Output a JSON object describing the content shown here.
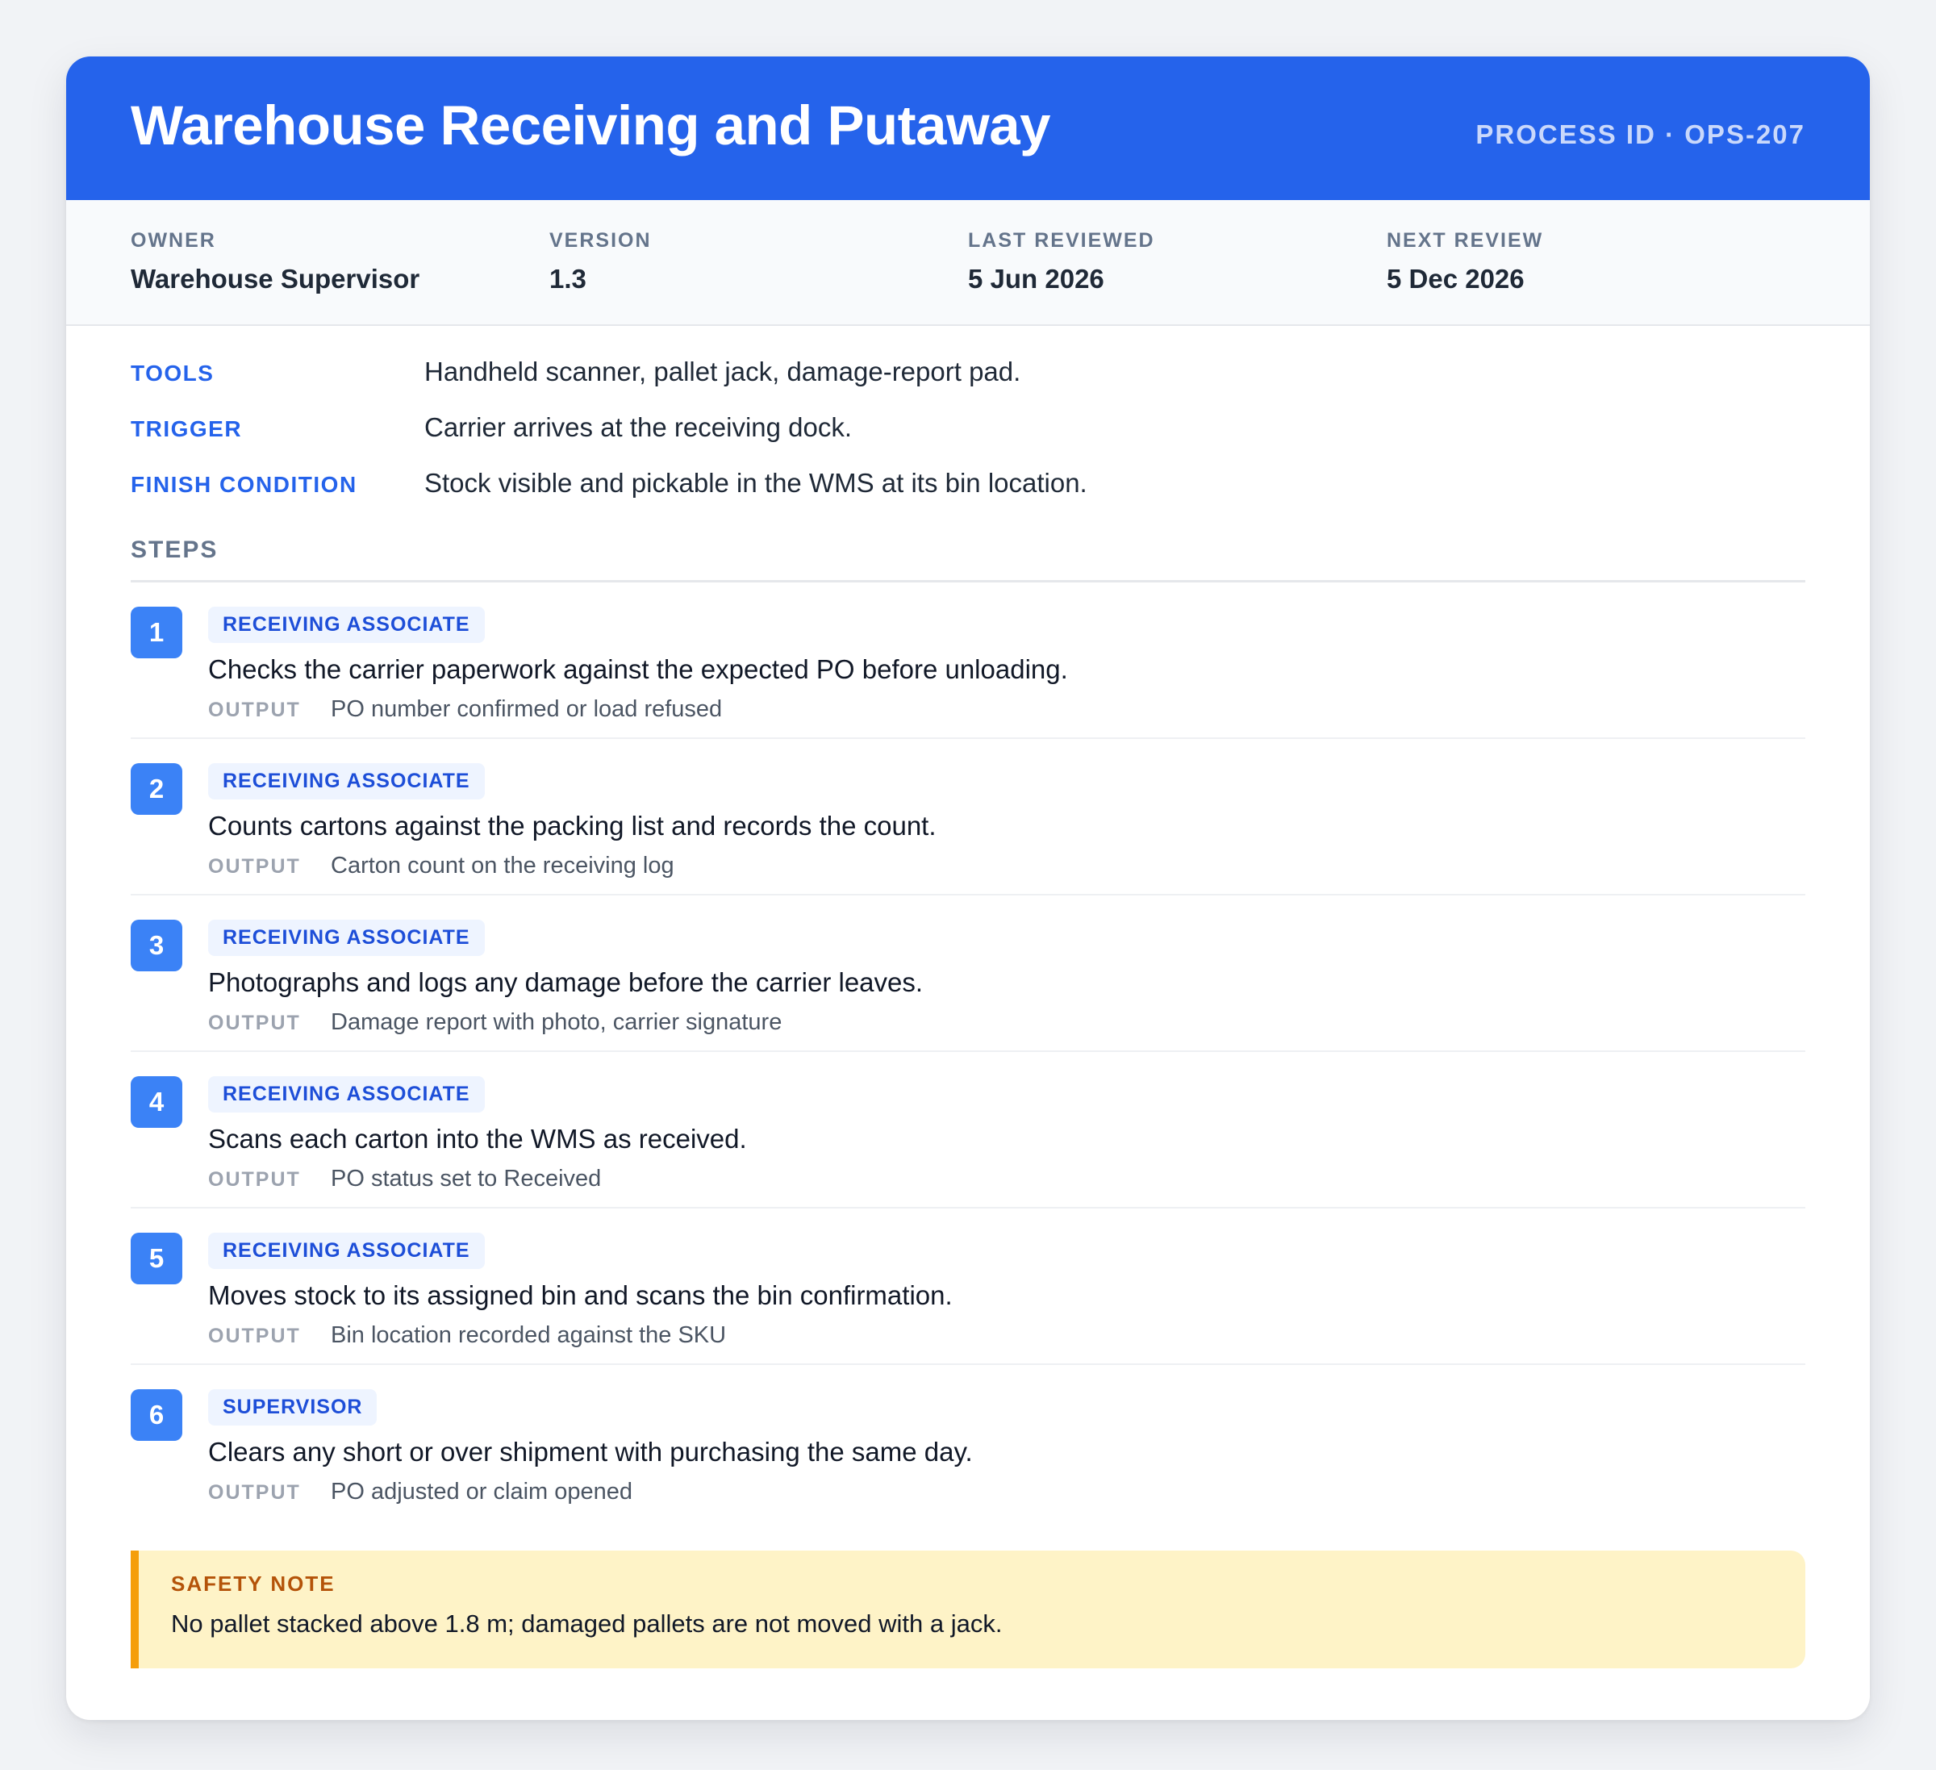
{
  "header": {
    "title": "Warehouse Receiving and Putaway",
    "process_id": "PROCESS ID · OPS-207"
  },
  "meta": [
    {
      "label": "OWNER",
      "value": "Warehouse Supervisor"
    },
    {
      "label": "VERSION",
      "value": "1.3"
    },
    {
      "label": "LAST REVIEWED",
      "value": "5 Jun 2026"
    },
    {
      "label": "NEXT REVIEW",
      "value": "5 Dec 2026"
    }
  ],
  "info": {
    "tools": {
      "label": "TOOLS",
      "value": "Handheld scanner, pallet jack, damage-report pad."
    },
    "trigger": {
      "label": "TRIGGER",
      "value": "Carrier arrives at the receiving dock."
    },
    "finish": {
      "label": "FINISH CONDITION",
      "value": "Stock visible and pickable in the WMS at its bin location."
    }
  },
  "steps_heading": "STEPS",
  "output_label": "OUTPUT",
  "steps": [
    {
      "num": "1",
      "role": "RECEIVING ASSOCIATE",
      "text": "Checks the carrier paperwork against the expected PO before unloading.",
      "output": "PO number confirmed or load refused"
    },
    {
      "num": "2",
      "role": "RECEIVING ASSOCIATE",
      "text": "Counts cartons against the packing list and records the count.",
      "output": "Carton count on the receiving log"
    },
    {
      "num": "3",
      "role": "RECEIVING ASSOCIATE",
      "text": "Photographs and logs any damage before the carrier leaves.",
      "output": "Damage report with photo, carrier signature"
    },
    {
      "num": "4",
      "role": "RECEIVING ASSOCIATE",
      "text": "Scans each carton into the WMS as received.",
      "output": "PO status set to Received"
    },
    {
      "num": "5",
      "role": "RECEIVING ASSOCIATE",
      "text": "Moves stock to its assigned bin and scans the bin confirmation.",
      "output": "Bin location recorded against the SKU"
    },
    {
      "num": "6",
      "role": "SUPERVISOR",
      "text": "Clears any short or over shipment with purchasing the same day.",
      "output": "PO adjusted or claim opened"
    }
  ],
  "safety": {
    "label": "SAFETY NOTE",
    "text": "No pallet stacked above 1.8 m; damaged pallets are not moved with a jack."
  }
}
